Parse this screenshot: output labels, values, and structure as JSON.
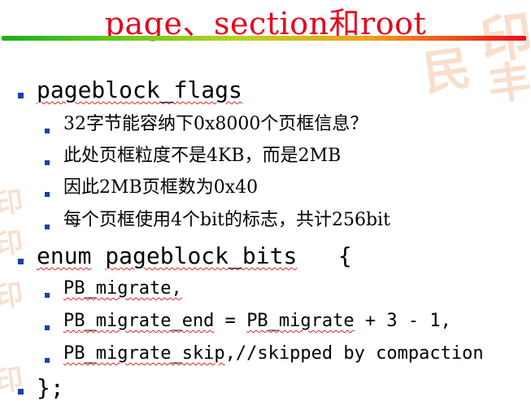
{
  "title": "page、section和root",
  "items": [
    {
      "text": "pageblock_flags"
    },
    {
      "text": "32字节能容纳下0x8000个页框信息？"
    },
    {
      "text": "此处页框粒度不是4KB，而是2MB"
    },
    {
      "text": "因此2MB页框数为0x40"
    },
    {
      "text": "每个页框使用4个bit的标志，共计256bit"
    },
    {
      "part1": "enum",
      "part2": "pageblock_bits",
      "part3": "   {"
    },
    {
      "text": "PB_migrate,"
    },
    {
      "part1": "PB_migrate_end",
      "part2": " = ",
      "part3": "PB_migrate",
      "part4": " + 3 - 1,"
    },
    {
      "part1": "PB_migrate_skip",
      "part2": ",//skipped by compaction"
    },
    {
      "text": "};"
    }
  ],
  "colors": {
    "title": "#e8001c",
    "bullet": "#1a3fb0",
    "squiggle": "#e6202a"
  }
}
